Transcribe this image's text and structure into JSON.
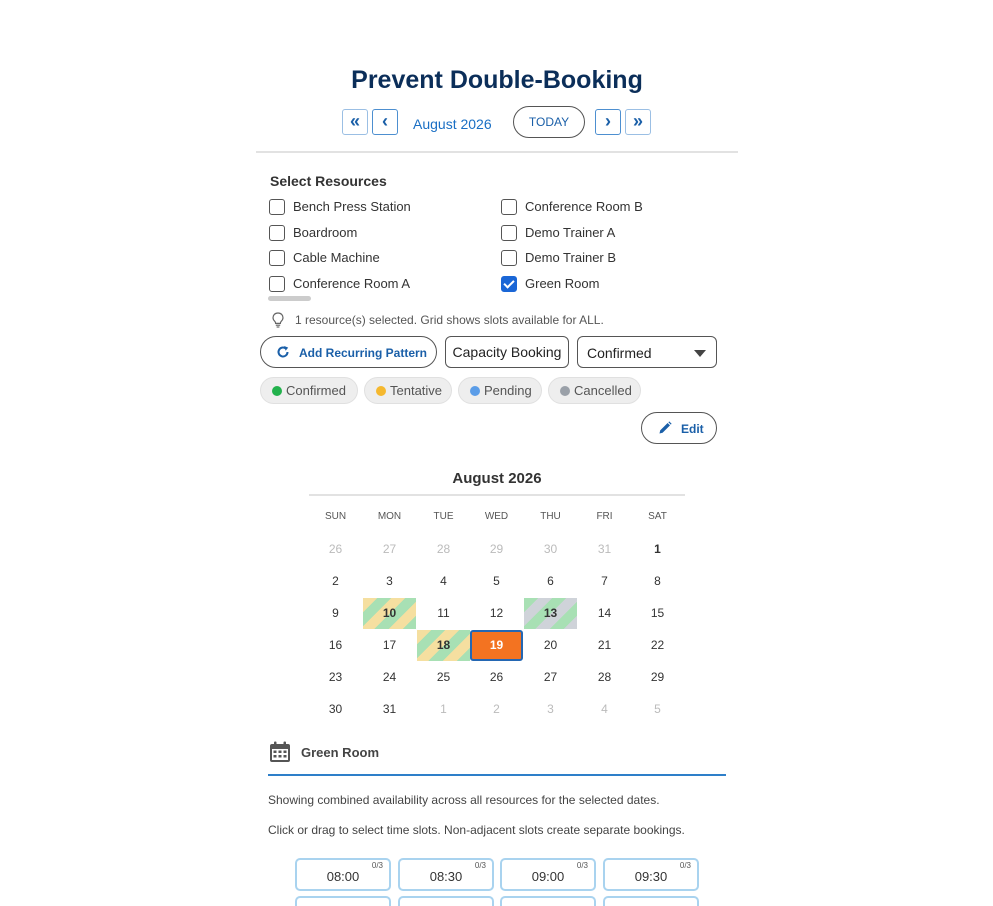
{
  "page": {
    "title": "Prevent Double-Booking"
  },
  "nav": {
    "first_label": "«",
    "prev_label": "‹",
    "month": "August 2026",
    "today_label": "TODAY",
    "next_label": "›",
    "last_label": "»"
  },
  "resources": {
    "title": "Select Resources",
    "items": [
      {
        "label": "Bench Press Station",
        "checked": false
      },
      {
        "label": "Boardroom",
        "checked": false
      },
      {
        "label": "Cable Machine",
        "checked": false
      },
      {
        "label": "Conference Room A",
        "checked": false
      },
      {
        "label": "Conference Room B",
        "checked": false
      },
      {
        "label": "Demo Trainer A",
        "checked": false
      },
      {
        "label": "Demo Trainer B",
        "checked": false
      },
      {
        "label": "Green Room",
        "checked": true
      }
    ],
    "hint": "1 resource(s) selected. Grid shows slots available for ALL.",
    "hint_icon": "lightbulb-icon"
  },
  "toolbar": {
    "recurring_label": "Add Recurring Pattern",
    "recurring_icon": "refresh-icon",
    "capacity_label": "Capacity Booking",
    "status_value": "Confirmed"
  },
  "legend": [
    {
      "label": "Confirmed",
      "color": "#22b14c"
    },
    {
      "label": "Tentative",
      "color": "#f5b82e"
    },
    {
      "label": "Pending",
      "color": "#5b9de8"
    },
    {
      "label": "Cancelled",
      "color": "#9aa0a8"
    }
  ],
  "edit": {
    "label": "Edit",
    "icon": "pencil-icon"
  },
  "calendar": {
    "title": "August 2026",
    "weekdays": [
      "SUN",
      "MON",
      "TUE",
      "WED",
      "THU",
      "FRI",
      "SAT"
    ],
    "weeks": [
      [
        "26",
        "27",
        "28",
        "29",
        "30",
        "31",
        "1"
      ],
      [
        "2",
        "3",
        "4",
        "5",
        "6",
        "7",
        "8"
      ],
      [
        "9",
        "10",
        "11",
        "12",
        "13",
        "14",
        "15"
      ],
      [
        "16",
        "17",
        "18",
        "19",
        "20",
        "21",
        "22"
      ],
      [
        "23",
        "24",
        "25",
        "26",
        "27",
        "28",
        "29"
      ],
      [
        "30",
        "31",
        "1",
        "2",
        "3",
        "4",
        "5"
      ]
    ],
    "selected_day": "19",
    "marked_days": {
      "10": "confirmed-tentative",
      "13": "confirmed-cancelled",
      "18": "confirmed-tentative"
    },
    "colors": {
      "selected": "#f37321",
      "selected_border": "#2467b3"
    }
  },
  "room": {
    "name": "Green Room",
    "icon": "calendar-icon",
    "info1": "Showing combined availability across all resources for the selected dates.",
    "info2": "Click or drag to select time slots. Non-adjacent slots create separate bookings."
  },
  "slots": [
    {
      "time": "08:00",
      "capacity": "0/3"
    },
    {
      "time": "08:30",
      "capacity": "0/3"
    },
    {
      "time": "09:00",
      "capacity": "0/3"
    },
    {
      "time": "09:30",
      "capacity": "0/3"
    }
  ]
}
